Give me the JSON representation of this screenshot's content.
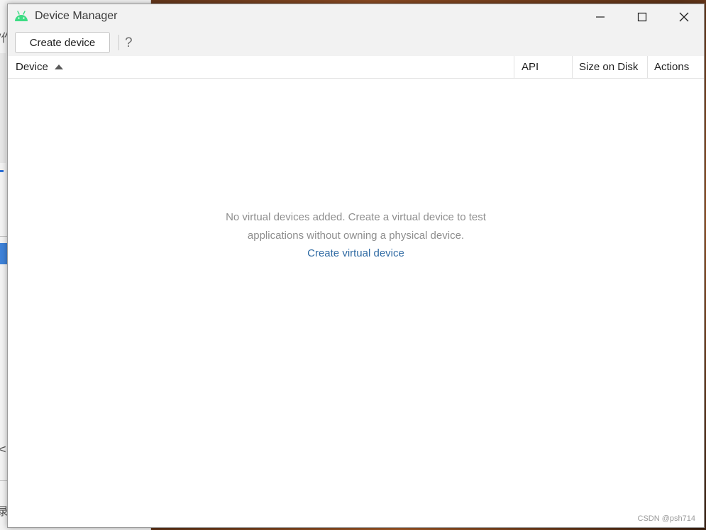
{
  "window": {
    "title": "Device Manager",
    "icon": "android-icon",
    "controls": {
      "minimize_icon": "minimize-icon",
      "maximize_icon": "maximize-icon",
      "close_icon": "close-icon"
    }
  },
  "toolbar": {
    "create_label": "Create device",
    "help_label": "?"
  },
  "table": {
    "columns": [
      {
        "label": "Device",
        "sorted": "ascending"
      },
      {
        "label": "API"
      },
      {
        "label": "Size on Disk"
      },
      {
        "label": "Actions"
      }
    ],
    "rows": []
  },
  "empty_state": {
    "message": "No virtual devices added. Create a virtual device to test applications without owning a physical device.",
    "link_label": "Create virtual device"
  },
  "watermark": "CSDN @psh714",
  "colors": {
    "android_green": "#3ddc84",
    "link": "#2f6aa3",
    "muted_text": "#8e8e8e"
  }
}
